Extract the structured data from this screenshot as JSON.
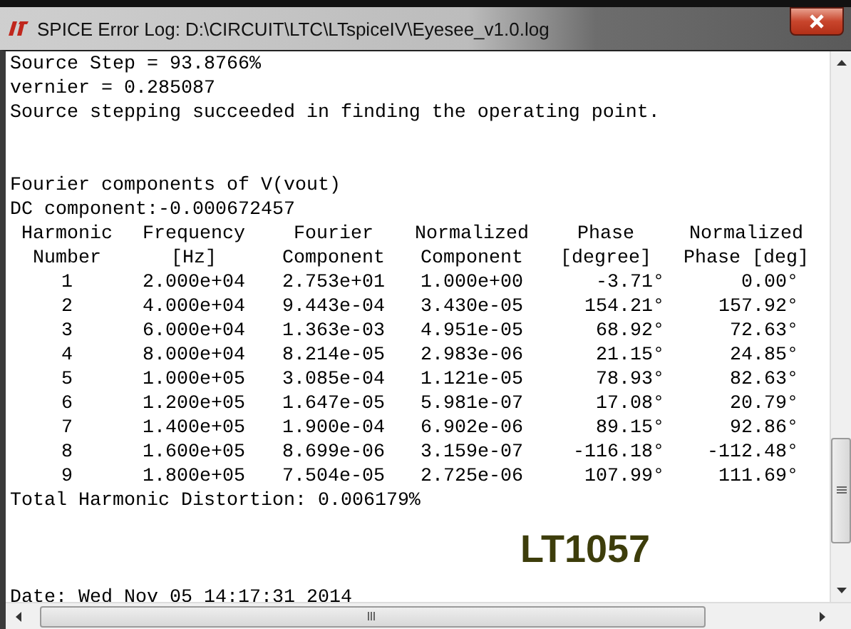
{
  "window": {
    "title": "SPICE Error Log: D:\\CIRCUIT\\LTC\\LTspiceIV\\Eyesee_v1.0.log"
  },
  "log": {
    "intro": [
      "Source Step = 93.8766%",
      "vernier = 0.285087",
      "Source stepping succeeded in finding the operating point."
    ],
    "fourier": [
      "Fourier components of V(vout)",
      "DC component:-0.000672457"
    ],
    "table": {
      "header_rows": [
        [
          "Harmonic",
          "Frequency",
          "Fourier",
          "Normalized",
          "Phase",
          "Normalized"
        ],
        [
          "Number",
          "[Hz]",
          "Component",
          "Component",
          "[degree]",
          "Phase [deg]"
        ]
      ],
      "rows": [
        [
          "1",
          "2.000e+04",
          "2.753e+01",
          "1.000e+00",
          "-3.71°",
          "0.00°"
        ],
        [
          "2",
          "4.000e+04",
          "9.443e-04",
          "3.430e-05",
          "154.21°",
          "157.92°"
        ],
        [
          "3",
          "6.000e+04",
          "1.363e-03",
          "4.951e-05",
          "68.92°",
          "72.63°"
        ],
        [
          "4",
          "8.000e+04",
          "8.214e-05",
          "2.983e-06",
          "21.15°",
          "24.85°"
        ],
        [
          "5",
          "1.000e+05",
          "3.085e-04",
          "1.121e-05",
          "78.93°",
          "82.63°"
        ],
        [
          "6",
          "1.200e+05",
          "1.647e-05",
          "5.981e-07",
          "17.08°",
          "20.79°"
        ],
        [
          "7",
          "1.400e+05",
          "1.900e-04",
          "6.902e-06",
          "89.15°",
          "92.86°"
        ],
        [
          "8",
          "1.600e+05",
          "8.699e-06",
          "3.159e-07",
          "-116.18°",
          "-112.48°"
        ],
        [
          "9",
          "1.800e+05",
          "7.504e-05",
          "2.725e-06",
          "107.99°",
          "111.69°"
        ]
      ]
    },
    "thd": "Total Harmonic Distortion: 0.006179%",
    "annotation": "LT1057",
    "date": "Date: Wed Nov 05 14:17:31 2014"
  }
}
